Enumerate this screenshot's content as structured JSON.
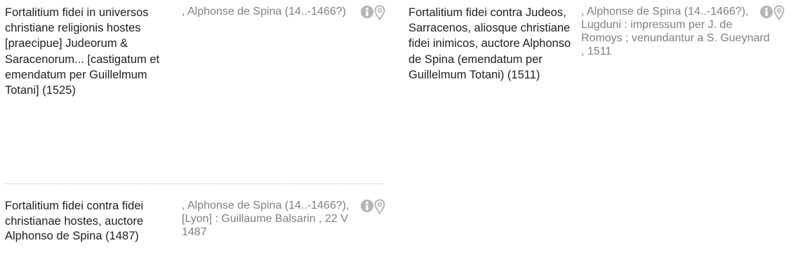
{
  "results": [
    {
      "title": "Fortalitium fidei in universos christiane religionis hostes [praecipue] Judeorum & Saracenorum... [castigatum et emendatum per Guillelmum Totani] (1525)",
      "meta": ", Alphonse de Spina (14..-1466?)",
      "info_icon": "info-circle-icon",
      "location_icon": "map-pin-icon"
    },
    {
      "title": "Fortalitium fidei contra Judeos, Sarracenos, aliosque christiane fidei inimicos, auctore Alphonso de Spina (emendatum per Guillelmum Totani) (1511)",
      "meta": ", Alphonse de Spina (14..-1466?), Lugduni : impressum per J. de Romoys ; venundantur a S. Gueynard , 1511",
      "info_icon": "info-circle-icon",
      "location_icon": "map-pin-icon"
    },
    {
      "title": "Fortalitium fidei contra fidei christianae hostes, auctore Alphonso de Spina (1487)",
      "meta": ", Alphonse de Spina (14..-1466?), [Lyon] : Guillaume Balsarin , 22 V 1487",
      "info_icon": "info-circle-icon",
      "location_icon": "map-pin-icon"
    }
  ],
  "colors": {
    "title_text": "#1f1f1f",
    "meta_text": "#808080",
    "icon": "#b5b5b5",
    "divider": "#b8c2cc"
  }
}
